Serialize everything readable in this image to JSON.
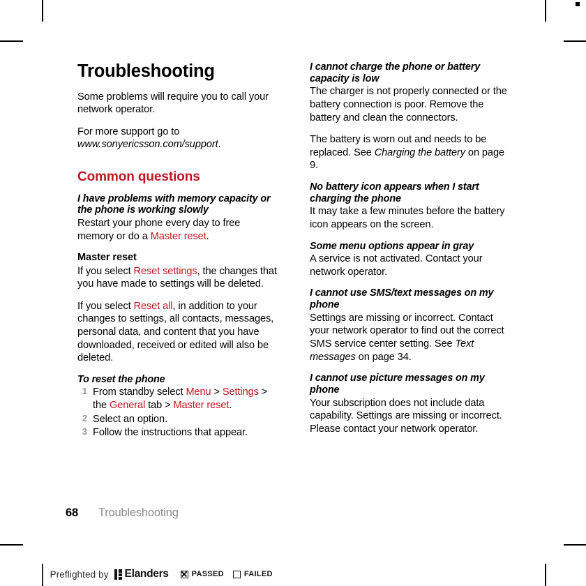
{
  "document": {
    "title": "Troubleshooting",
    "intro_paragraph": "Some problems will require you to call your network operator.",
    "support_lead": "For more support go to ",
    "support_url": "www.sonyericsson.com/support",
    "support_tail": "."
  },
  "section": {
    "heading": "Common questions"
  },
  "left_column": {
    "q1": {
      "question": "I have problems with memory capacity or the phone is working slowly",
      "answer_pre": "Restart your phone every day to free memory or do a ",
      "answer_link": "Master reset",
      "answer_post": "."
    },
    "master_reset": {
      "heading": "Master reset",
      "p1_pre": "If you select ",
      "p1_link": "Reset settings",
      "p1_post": ", the changes that you have made to settings will be deleted.",
      "p2_pre": "If you select ",
      "p2_link": "Reset all",
      "p2_post": ", in addition to your changes to settings, all contacts, messages, personal data, and content that you have downloaded, received or edited will also be deleted."
    },
    "procedure": {
      "heading": "To reset the phone",
      "steps": [
        {
          "num": "1",
          "pre": "From standby select ",
          "link1": "Menu",
          "sep1": " > ",
          "link2": "Settings",
          "mid": " > the ",
          "link3": "General",
          "sep2": " tab > ",
          "link4": "Master reset",
          "post": "."
        },
        {
          "num": "2",
          "text": "Select an option."
        },
        {
          "num": "3",
          "text": "Follow the instructions that appear."
        }
      ]
    }
  },
  "right_column": {
    "q2": {
      "question": "I cannot charge the phone or battery capacity is low",
      "p1": "The charger is not properly connected or the battery connection is poor. Remove the battery and clean the connectors.",
      "p2_pre": "The battery is worn out and needs to be replaced. See ",
      "p2_ital": "Charging the battery",
      "p2_post": " on page 9."
    },
    "q3": {
      "question": "No battery icon appears when I start charging the phone",
      "answer": "It may take a few minutes before the battery icon appears on the screen."
    },
    "q4": {
      "question": "Some menu options appear in gray",
      "answer": "A service is not activated. Contact your network operator."
    },
    "q5": {
      "question": "I cannot use SMS/text messages on my phone",
      "answer_pre": "Settings are missing or incorrect. Contact your network operator to find out the correct SMS service center setting. See ",
      "answer_ital": "Text messages",
      "answer_post": " on page 34."
    },
    "q6": {
      "question": "I cannot use picture messages on my phone",
      "answer": "Your subscription does not include data capability. Settings are missing or incorrect. Please contact your network operator."
    }
  },
  "footer": {
    "page_number": "68",
    "running_head": "Troubleshooting"
  },
  "preflight": {
    "label": "Preflighted by",
    "brand": "Elanders",
    "passed_label": "PASSED",
    "failed_label": "FAILED"
  },
  "colors": {
    "accent_red": "#BE1622",
    "step_number_gray": "#9C9093",
    "running_head_gray": "#8A8A8A"
  }
}
